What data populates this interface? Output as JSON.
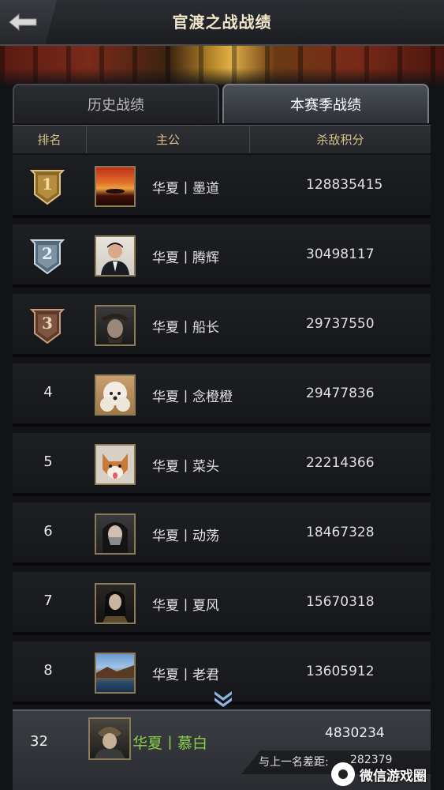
{
  "header": {
    "title": "官渡之战战绩"
  },
  "tabs": [
    {
      "label": "历史战绩",
      "active": false
    },
    {
      "label": "本赛季战绩",
      "active": true
    }
  ],
  "columns": {
    "rank": "排名",
    "lord": "主公",
    "score": "杀敌积分"
  },
  "rows": [
    {
      "rank": "1",
      "medal": "gold",
      "name": "华夏丨墨道",
      "score": "128835415",
      "avatar_icon": "sunset-avatar"
    },
    {
      "rank": "2",
      "medal": "silver",
      "name": "华夏丨腾辉",
      "score": "30498117",
      "avatar_icon": "man-suit-avatar"
    },
    {
      "rank": "3",
      "medal": "bronze",
      "name": "华夏丨船长",
      "score": "29737550",
      "avatar_icon": "pirate-avatar"
    },
    {
      "rank": "4",
      "medal": "",
      "name": "华夏丨念橙橙",
      "score": "29477836",
      "avatar_icon": "white-dog-avatar"
    },
    {
      "rank": "5",
      "medal": "",
      "name": "华夏丨菜头",
      "score": "22214366",
      "avatar_icon": "shiba-avatar"
    },
    {
      "rank": "6",
      "medal": "",
      "name": "华夏丨动荡",
      "score": "18467328",
      "avatar_icon": "masked-girl-avatar"
    },
    {
      "rank": "7",
      "medal": "",
      "name": "华夏丨夏风",
      "score": "15670318",
      "avatar_icon": "warrior-avatar"
    },
    {
      "rank": "8",
      "medal": "",
      "name": "华夏丨老君",
      "score": "13605912",
      "avatar_icon": "landscape-avatar"
    }
  ],
  "me": {
    "rank": "32",
    "name": "华夏丨慕白",
    "score": "4830234",
    "gap_label": "与上一名差距:",
    "gap_value": "282379",
    "avatar_icon": "armored-general-avatar"
  },
  "watermark": {
    "text": "微信游戏圈"
  },
  "colors": {
    "gold": "#c9a24c",
    "silver": "#9fb3c4",
    "bronze": "#9b6b4e",
    "my_name": "#8bd04a",
    "header_text": "#d9c08a"
  }
}
